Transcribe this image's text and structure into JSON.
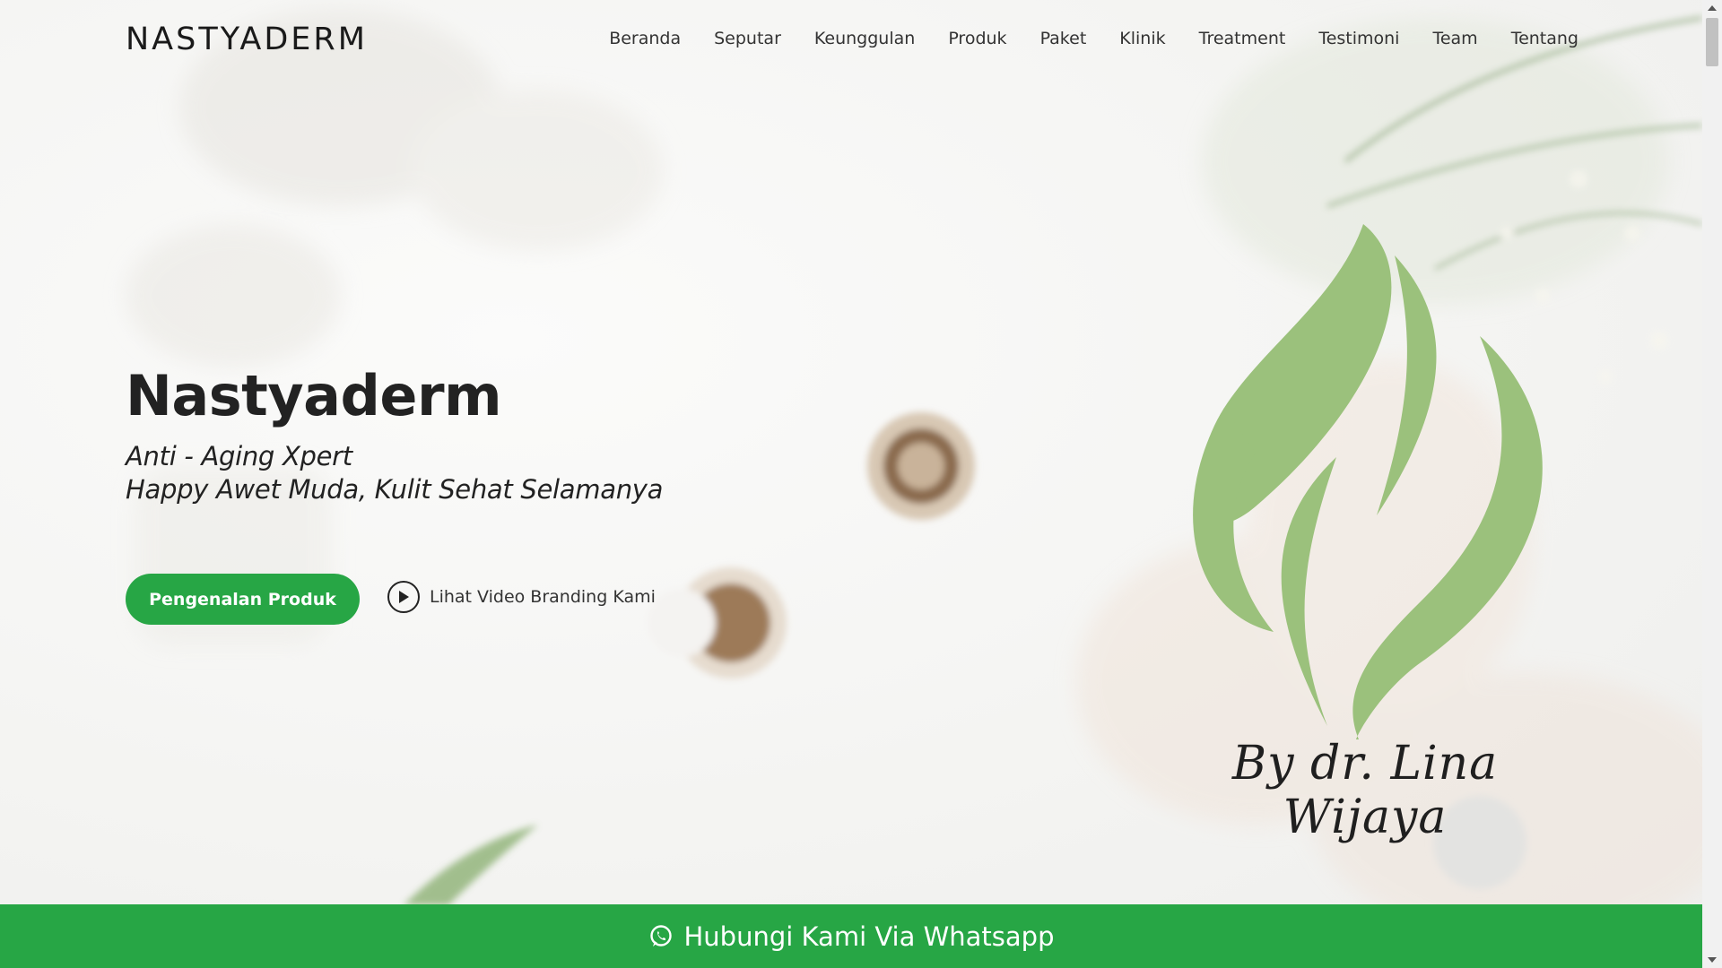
{
  "header": {
    "logo": "NASTYADERM",
    "nav": [
      "Beranda",
      "Seputar",
      "Keunggulan",
      "Produk",
      "Paket",
      "Klinik",
      "Treatment",
      "Testimoni",
      "Team",
      "Tentang"
    ]
  },
  "hero": {
    "title": "Nastyaderm",
    "subtitle_line1": "Anti - Aging Xpert",
    "subtitle_line2": "Happy Awet Muda, Kulit Sehat Selamanya",
    "primary_button": "Pengenalan Produk",
    "video_link": "Lihat Video Branding Kami"
  },
  "brand": {
    "signature": "By dr. Lina Wijaya",
    "leaf_color": "#9bc17c"
  },
  "whatsapp": {
    "label": "Hubungi Kami Via Whatsapp"
  },
  "colors": {
    "accent": "#27a645",
    "text": "#222222"
  },
  "icons": {
    "play": "play-icon",
    "whatsapp": "whatsapp-icon"
  }
}
